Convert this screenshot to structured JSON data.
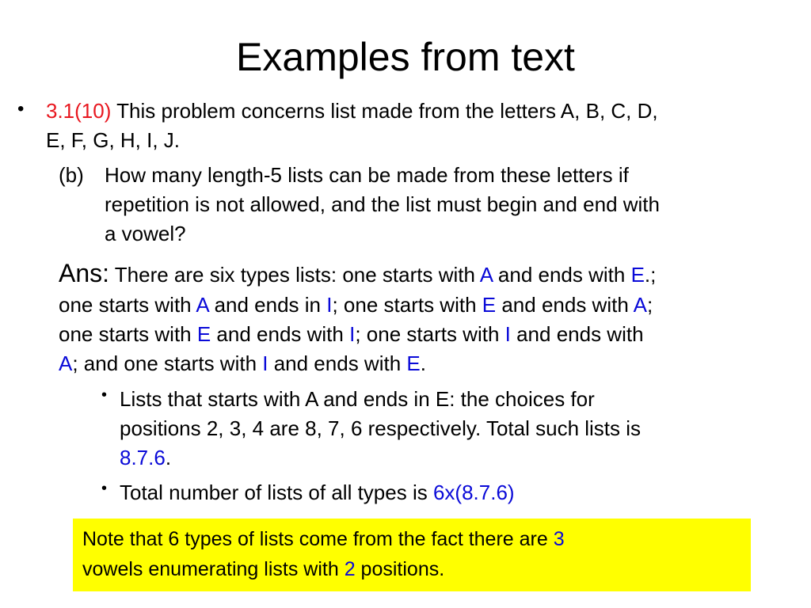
{
  "title": "Examples from text",
  "problem": {
    "bullet": "•",
    "ref": "3.1(10)",
    "line1_rest": " This problem concerns list made from the letters A, B, C, D,",
    "line2": "E, F, G, H, I, J.",
    "part_label": "(b)",
    "part_lines": [
      "How many length-5 lists can be made from these letters if",
      "repetition is not allowed, and the list must begin and end with",
      "a vowel?"
    ]
  },
  "answer": {
    "label": "Ans:",
    "lines": [
      [
        {
          "t": " There are six types lists: one starts with ",
          "c": ""
        },
        {
          "t": "A",
          "c": "blue"
        },
        {
          "t": " and ends with ",
          "c": ""
        },
        {
          "t": "E",
          "c": "blue"
        },
        {
          "t": ".;",
          "c": ""
        }
      ],
      [
        {
          "t": "one starts with ",
          "c": ""
        },
        {
          "t": "A",
          "c": "blue"
        },
        {
          "t": " and ends in ",
          "c": ""
        },
        {
          "t": "I",
          "c": "blue"
        },
        {
          "t": "; one starts with ",
          "c": ""
        },
        {
          "t": "E",
          "c": "blue"
        },
        {
          "t": " and ends with ",
          "c": ""
        },
        {
          "t": "A",
          "c": "blue"
        },
        {
          "t": ";",
          "c": ""
        }
      ],
      [
        {
          "t": "one starts with ",
          "c": ""
        },
        {
          "t": "E",
          "c": "blue"
        },
        {
          "t": " and ends with ",
          "c": ""
        },
        {
          "t": "I",
          "c": "blue"
        },
        {
          "t": "; one starts with ",
          "c": ""
        },
        {
          "t": "I",
          "c": "blue"
        },
        {
          "t": " and ends with",
          "c": ""
        }
      ],
      [
        {
          "t": "A",
          "c": "blue"
        },
        {
          "t": "; and one starts with ",
          "c": ""
        },
        {
          "t": "I",
          "c": "blue"
        },
        {
          "t": " and ends with ",
          "c": ""
        },
        {
          "t": "E",
          "c": "blue"
        },
        {
          "t": ".",
          "c": ""
        }
      ]
    ]
  },
  "sub_bullets": [
    {
      "lines": [
        [
          {
            "t": "Lists that starts with A and ends in E: the choices for",
            "c": ""
          }
        ],
        [
          {
            "t": "positions 2, 3, 4 are 8, 7, 6 respectively. Total such lists is",
            "c": ""
          }
        ],
        [
          {
            "t": "8.7.6",
            "c": "blue"
          },
          {
            "t": ".",
            "c": ""
          }
        ]
      ]
    },
    {
      "lines": [
        [
          {
            "t": "Total number of lists of all types  is ",
            "c": ""
          },
          {
            "t": "6x(8.7.6)",
            "c": "blue"
          }
        ]
      ]
    }
  ],
  "note": {
    "lines": [
      [
        {
          "t": "Note that 6 types of lists come from the fact there are ",
          "c": ""
        },
        {
          "t": "3",
          "c": "blue"
        }
      ],
      [
        {
          "t": "vowels enumerating lists with ",
          "c": ""
        },
        {
          "t": "2",
          "c": "blue"
        },
        {
          "t": " positions.",
          "c": ""
        }
      ]
    ],
    "background": "#ffff00"
  },
  "colors": {
    "reference": "#e8171f",
    "highlight": "#0a0ad8"
  }
}
